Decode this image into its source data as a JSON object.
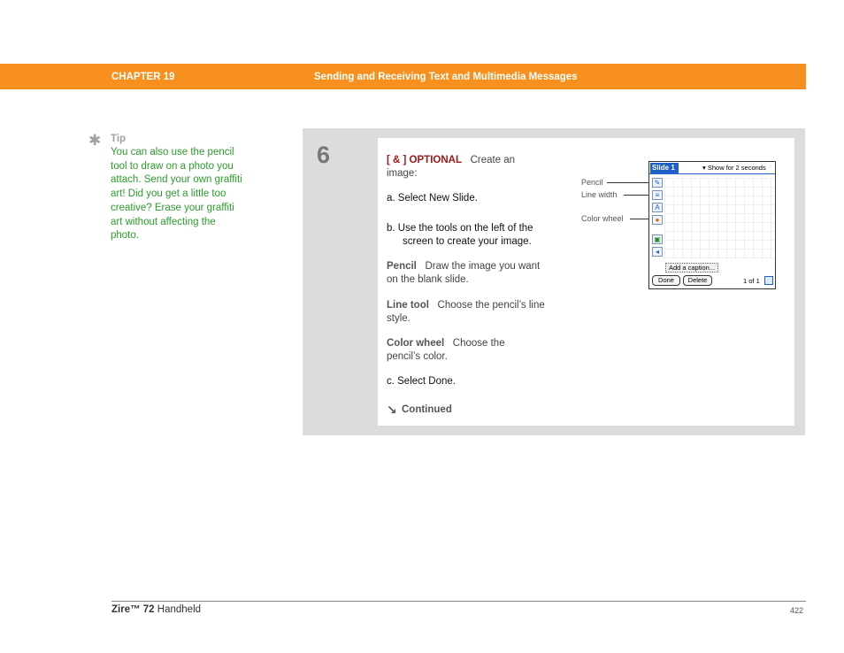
{
  "header": {
    "chapter": "CHAPTER 19",
    "title": "Sending and Receiving Text and Multimedia Messages"
  },
  "tip": {
    "icon": "asterisk-icon",
    "heading": "Tip",
    "text": "You can also use the pencil tool to draw on a photo you attach. Send your own graffiti art! Did you get a little too creative? Erase your graffiti art without affecting the photo."
  },
  "step": {
    "number": "6",
    "optional_tag": "[ & ]  OPTIONAL",
    "intro": "Create an image:",
    "a": "a.  Select New Slide.",
    "b": "b.  Use the tools on the left of the screen to create your image.",
    "pencil_term": "Pencil",
    "pencil_desc": "Draw the image you want on the blank slide.",
    "line_term": "Line tool",
    "line_desc": "Choose the pencil’s line style.",
    "color_term": "Color wheel",
    "color_desc": "Choose the pencil’s color.",
    "c": "c.  Select Done.",
    "continued": "Continued"
  },
  "device": {
    "slide_title": "Slide 1",
    "show_for": "▾ Show for 2 seconds",
    "add_caption": "Add a caption...",
    "done": "Done",
    "delete": "Delete",
    "page_of": "1 of 1",
    "callouts": {
      "pencil": "Pencil",
      "line_width": "Line width",
      "color_wheel": "Color wheel"
    }
  },
  "footer": {
    "brand": "Zire™ 72",
    "product": "Handheld",
    "page": "422"
  },
  "colors": {
    "header_orange": "#f7901e",
    "tip_green": "#2b9b2b",
    "optional_red": "#a01818"
  }
}
